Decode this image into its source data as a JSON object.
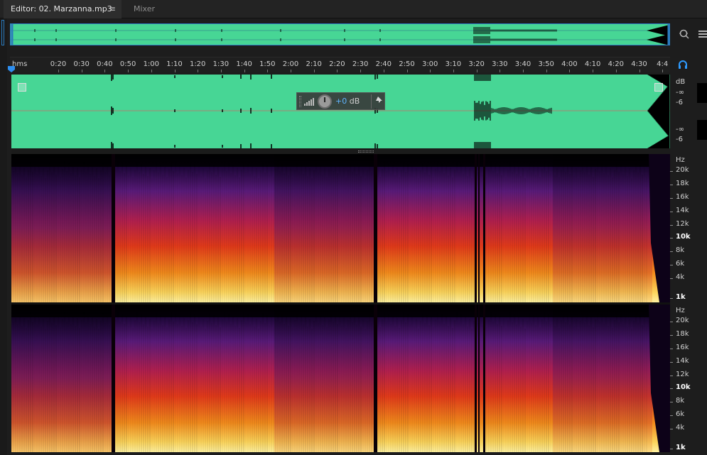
{
  "tabs": {
    "editor_label": "Editor: 02. Marzanna.mp3",
    "editor_menu_icon": "≡",
    "mixer_label": "Mixer"
  },
  "icons": {
    "zoom": "zoom-icon",
    "panel": "panel-icon",
    "headphones": "headphones-icon",
    "pin": "pin-icon"
  },
  "ruler": {
    "unit": "hms",
    "labels": [
      "0:20",
      "0:30",
      "0:40",
      "0:50",
      "1:00",
      "1:10",
      "1:20",
      "1:30",
      "1:40",
      "1:50",
      "2:00",
      "2:10",
      "2:20",
      "2:30",
      "2:40",
      "2:50",
      "3:00",
      "3:10",
      "3:20",
      "3:30",
      "3:40",
      "3:50",
      "4:00",
      "4:10",
      "4:20",
      "4:30",
      "4:4"
    ]
  },
  "hud": {
    "value": "+0",
    "unit": "dB"
  },
  "amplitude_scale": {
    "unit": "dB",
    "ch1": [
      "-∞",
      "-6"
    ],
    "ch2": [
      "-∞",
      "-6"
    ]
  },
  "spectral_scale": {
    "unit": "Hz",
    "labels": [
      "20k",
      "18k",
      "16k",
      "14k",
      "12k",
      "10k",
      "8k",
      "6k",
      "4k",
      "1k"
    ]
  },
  "colors": {
    "waveform_bg": "#47d695",
    "accent": "#2d7ec4",
    "hud_value": "#5fb4ff"
  }
}
